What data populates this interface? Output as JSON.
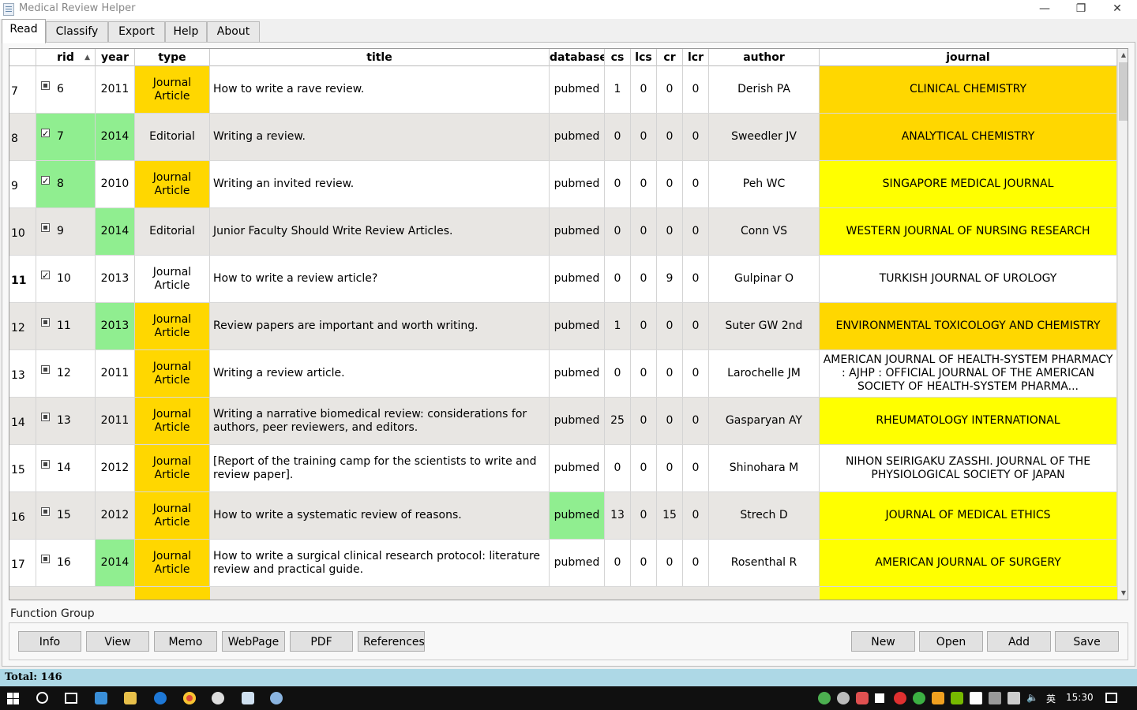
{
  "window": {
    "title": "Medical Review Helper",
    "minimize_glyph": "—",
    "restore_glyph": "❐",
    "close_glyph": "✕"
  },
  "tabs": [
    "Read",
    "Classify",
    "Export",
    "Help",
    "About"
  ],
  "table": {
    "headers": [
      "rid",
      "year",
      "type",
      "title",
      "database",
      "cs",
      "lcs",
      "cr",
      "lcr",
      "author",
      "journal"
    ],
    "sorted_column": "rid",
    "sort_glyph": "▲",
    "rows": [
      {
        "num": "7",
        "rid": "6",
        "checked": false,
        "year": "2011",
        "type": "Journal Article",
        "title": "How to write a rave review.",
        "database": "pubmed",
        "cs": "1",
        "lcs": "0",
        "cr": "0",
        "lcr": "0",
        "author": "Derish PA",
        "journal": "CLINICAL CHEMISTRY",
        "rid_bg": "",
        "year_bg": "",
        "type_bg": "gold",
        "db_bg": "",
        "journal_bg": "gold"
      },
      {
        "num": "8",
        "rid": "7",
        "checked": true,
        "year": "2014",
        "type": "Editorial",
        "title": "Writing a review.",
        "database": "pubmed",
        "cs": "0",
        "lcs": "0",
        "cr": "0",
        "lcr": "0",
        "author": "Sweedler JV",
        "journal": "ANALYTICAL CHEMISTRY",
        "rid_bg": "green",
        "year_bg": "green",
        "type_bg": "",
        "db_bg": "",
        "journal_bg": "gold"
      },
      {
        "num": "9",
        "rid": "8",
        "checked": true,
        "year": "2010",
        "type": "Journal Article",
        "title": "Writing an invited review.",
        "database": "pubmed",
        "cs": "0",
        "lcs": "0",
        "cr": "0",
        "lcr": "0",
        "author": "Peh WC",
        "journal": "SINGAPORE MEDICAL JOURNAL",
        "rid_bg": "green",
        "year_bg": "",
        "type_bg": "gold",
        "db_bg": "",
        "journal_bg": "yellow"
      },
      {
        "num": "10",
        "rid": "9",
        "checked": false,
        "year": "2014",
        "type": "Editorial",
        "title": "Junior Faculty Should Write Review Articles.",
        "database": "pubmed",
        "cs": "0",
        "lcs": "0",
        "cr": "0",
        "lcr": "0",
        "author": "Conn VS",
        "journal": "WESTERN JOURNAL OF NURSING RESEARCH",
        "rid_bg": "",
        "year_bg": "green",
        "type_bg": "",
        "db_bg": "",
        "journal_bg": "yellow"
      },
      {
        "num": "11",
        "rid": "10",
        "checked": true,
        "year": "2013",
        "type": "Journal Article",
        "title": "How to write a review article?",
        "database": "pubmed",
        "cs": "0",
        "lcs": "0",
        "cr": "9",
        "lcr": "0",
        "author": "Gulpinar O",
        "journal": "TURKISH JOURNAL OF UROLOGY",
        "rid_bg": "",
        "year_bg": "",
        "type_bg": "",
        "db_bg": "",
        "journal_bg": "",
        "current": true
      },
      {
        "num": "12",
        "rid": "11",
        "checked": false,
        "year": "2013",
        "type": "Journal Article",
        "title": "Review papers are important and worth writing.",
        "database": "pubmed",
        "cs": "1",
        "lcs": "0",
        "cr": "0",
        "lcr": "0",
        "author": "Suter GW 2nd",
        "journal": "ENVIRONMENTAL TOXICOLOGY AND CHEMISTRY",
        "rid_bg": "",
        "year_bg": "green",
        "type_bg": "gold",
        "db_bg": "",
        "journal_bg": "gold"
      },
      {
        "num": "13",
        "rid": "12",
        "checked": false,
        "year": "2011",
        "type": "Journal Article",
        "title": "Writing a review article.",
        "database": "pubmed",
        "cs": "0",
        "lcs": "0",
        "cr": "0",
        "lcr": "0",
        "author": "Larochelle JM",
        "journal": "AMERICAN JOURNAL OF HEALTH-SYSTEM PHARMACY : AJHP : OFFICIAL JOURNAL OF THE AMERICAN SOCIETY OF HEALTH-SYSTEM PHARMA...",
        "rid_bg": "",
        "year_bg": "",
        "type_bg": "gold",
        "db_bg": "",
        "journal_bg": ""
      },
      {
        "num": "14",
        "rid": "13",
        "checked": false,
        "year": "2011",
        "type": "Journal Article",
        "title": "Writing a narrative biomedical review: considerations for authors, peer reviewers, and editors.",
        "database": "pubmed",
        "cs": "25",
        "lcs": "0",
        "cr": "0",
        "lcr": "0",
        "author": "Gasparyan AY",
        "journal": "RHEUMATOLOGY INTERNATIONAL",
        "rid_bg": "",
        "year_bg": "",
        "type_bg": "gold",
        "db_bg": "",
        "journal_bg": "yellow"
      },
      {
        "num": "15",
        "rid": "14",
        "checked": false,
        "year": "2012",
        "type": "Journal Article",
        "title": "[Report of the training camp for the scientists to write and review paper].",
        "database": "pubmed",
        "cs": "0",
        "lcs": "0",
        "cr": "0",
        "lcr": "0",
        "author": "Shinohara M",
        "journal": "NIHON SEIRIGAKU ZASSHI. JOURNAL OF THE PHYSIOLOGICAL SOCIETY OF JAPAN",
        "rid_bg": "",
        "year_bg": "",
        "type_bg": "gold",
        "db_bg": "",
        "journal_bg": ""
      },
      {
        "num": "16",
        "rid": "15",
        "checked": false,
        "year": "2012",
        "type": "Journal Article",
        "title": "How to write a systematic review of reasons.",
        "database": "pubmed",
        "cs": "13",
        "lcs": "0",
        "cr": "15",
        "lcr": "0",
        "author": "Strech D",
        "journal": "JOURNAL OF MEDICAL ETHICS",
        "rid_bg": "",
        "year_bg": "",
        "type_bg": "gold",
        "db_bg": "green",
        "journal_bg": "yellow"
      },
      {
        "num": "17",
        "rid": "16",
        "checked": false,
        "year": "2014",
        "type": "Journal Article",
        "title": "How to write a surgical clinical research protocol: literature review and practical guide.",
        "database": "pubmed",
        "cs": "0",
        "lcs": "0",
        "cr": "0",
        "lcr": "0",
        "author": "Rosenthal R",
        "journal": "AMERICAN JOURNAL OF SURGERY",
        "rid_bg": "",
        "year_bg": "green",
        "type_bg": "gold",
        "db_bg": "",
        "journal_bg": "yellow"
      }
    ]
  },
  "function_group": {
    "label": "Function Group",
    "left_buttons": [
      "Info",
      "View",
      "Memo",
      "WebPage",
      "PDF",
      "References"
    ],
    "right_buttons": [
      "New",
      "Open",
      "Add",
      "Save"
    ]
  },
  "status": {
    "total": "Total: 146"
  },
  "taskbar": {
    "ime": "英",
    "clock": "15:30"
  },
  "colors": {
    "yellow": "#ffff00",
    "gold": "#ffd700",
    "green": "#90ee90",
    "status_bar": "#add8e6"
  }
}
